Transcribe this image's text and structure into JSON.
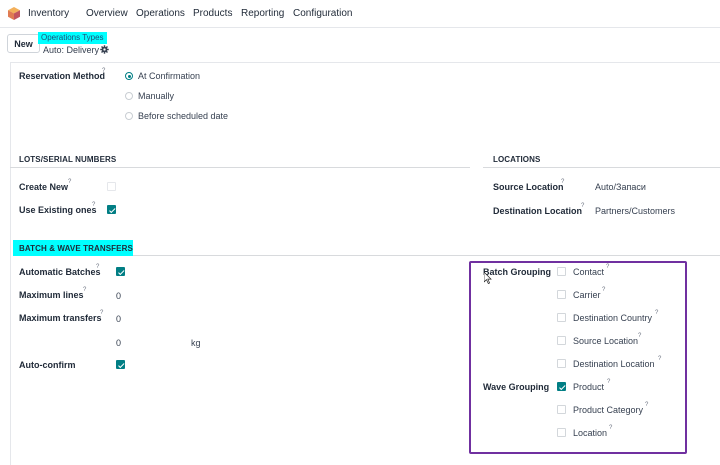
{
  "navbar": {
    "app_name": "Inventory",
    "menu": [
      "Overview",
      "Operations",
      "Products",
      "Reporting",
      "Configuration"
    ]
  },
  "control_panel": {
    "new_button": "New",
    "breadcrumb_parent": "Operations Types",
    "record_title": "Auto: Delivery"
  },
  "form": {
    "reservation": {
      "label": "Reservation Method",
      "options": [
        {
          "label": "At Confirmation",
          "selected": true
        },
        {
          "label": "Manually",
          "selected": false
        },
        {
          "label": "Before scheduled date",
          "selected": false
        }
      ]
    },
    "lots": {
      "title": "LOTS/SERIAL NUMBERS",
      "create_new": {
        "label": "Create New",
        "checked": false
      },
      "use_existing": {
        "label": "Use Existing ones",
        "checked": true
      }
    },
    "locations": {
      "title": "LOCATIONS",
      "source": {
        "label": "Source Location",
        "value": "Auto/Запаси"
      },
      "destination": {
        "label": "Destination Location",
        "value": "Partners/Customers"
      }
    },
    "batch": {
      "title": "BATCH & WAVE TRANSFERS",
      "automatic_batches": {
        "label": "Automatic Batches",
        "checked": true
      },
      "maximum_lines": {
        "label": "Maximum lines",
        "value": "0"
      },
      "maximum_transfers": {
        "label": "Maximum transfers",
        "value": "0"
      },
      "weight": {
        "value": "0",
        "unit": "kg"
      },
      "auto_confirm": {
        "label": "Auto-confirm",
        "checked": true
      },
      "batch_grouping": {
        "label": "Batch Grouping",
        "options": [
          {
            "label": "Contact",
            "checked": false
          },
          {
            "label": "Carrier",
            "checked": false
          },
          {
            "label": "Destination Country",
            "checked": false
          },
          {
            "label": "Source Location",
            "checked": false
          },
          {
            "label": "Destination Location",
            "checked": false
          }
        ]
      },
      "wave_grouping": {
        "label": "Wave Grouping",
        "options": [
          {
            "label": "Product",
            "checked": true
          },
          {
            "label": "Product Category",
            "checked": false
          },
          {
            "label": "Location",
            "checked": false
          }
        ]
      }
    },
    "help_mark": "?"
  },
  "colors": {
    "accent": "#017e84",
    "highlight": "#00ffff",
    "annotation_box": "#7030a0"
  }
}
